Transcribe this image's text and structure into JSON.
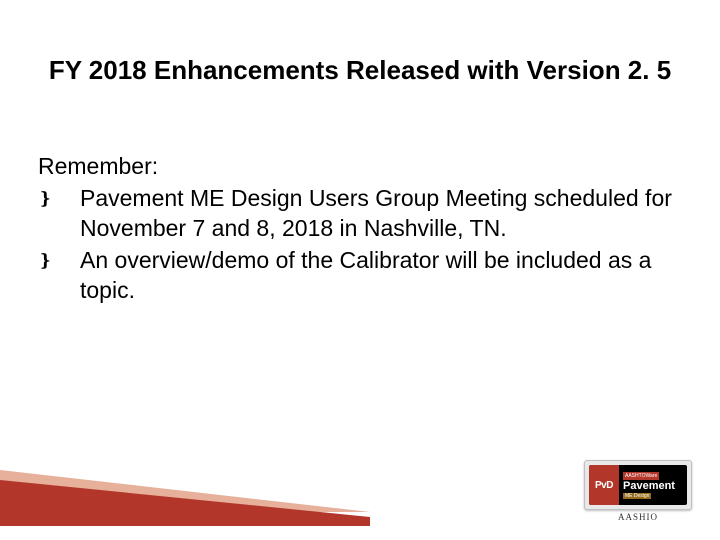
{
  "title": "FY 2018 Enhancements Released with Version 2. 5",
  "lead": "Remember:",
  "bullets": [
    {
      "marker": "❵",
      "text": "Pavement ME Design Users Group Meeting scheduled for November 7 and 8, 2018 in Nashville, TN."
    },
    {
      "marker": "❵",
      "text": "An overview/demo of the Calibrator will be included as a topic."
    }
  ],
  "logo": {
    "badge": "PvD",
    "topSmall": "AASHTOWare",
    "main": "Pavement",
    "sub": "ME Design",
    "caption": "AASHIO"
  },
  "colors": {
    "accent": "#b3362b",
    "shadow": "#e6b09a"
  }
}
